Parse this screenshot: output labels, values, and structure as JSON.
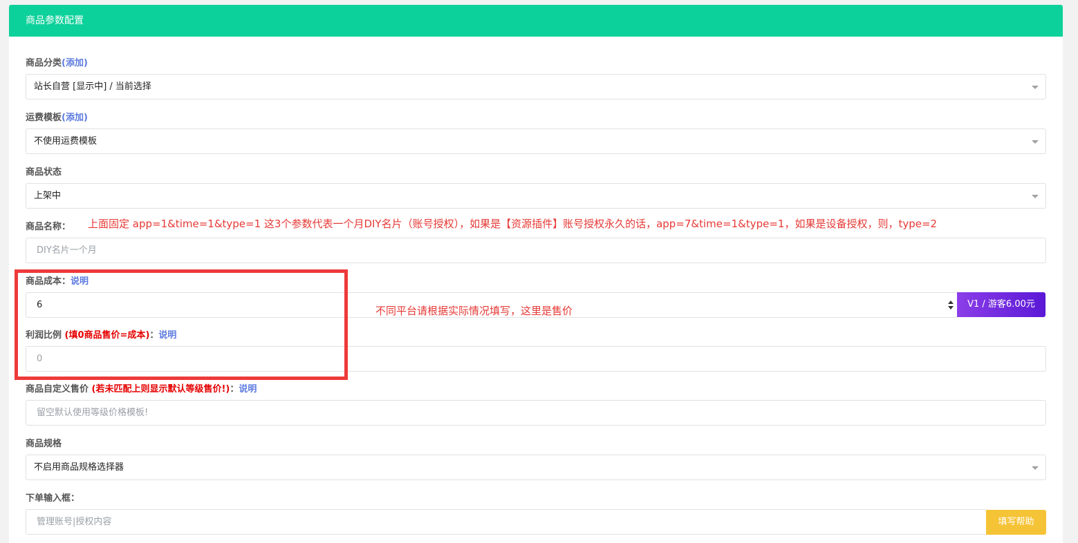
{
  "header": {
    "title": "商品参数配置"
  },
  "category": {
    "label": "商品分类",
    "link_open": "(",
    "link": "添加",
    "link_close": ")",
    "value": "站长自营 [显示中] / 当前选择"
  },
  "shipping": {
    "label": "运费模板",
    "link_open": "(",
    "link": "添加",
    "link_close": ")",
    "value": "不使用运费模板"
  },
  "status": {
    "label": "商品状态",
    "value": "上架中"
  },
  "name": {
    "label": "商品名称：",
    "placeholder": "DIY名片一个月"
  },
  "annotation_top": "上面固定  app=1&time=1&type=1   这3个参数代表一个月DIY名片（账号授权），如果是【资源插件】账号授权永久的话，app=7&time=1&type=1，如果是设备授权，则，type=2",
  "cost": {
    "label": "商品成本：",
    "link": "说明",
    "value": "6",
    "addon": "V1 / 游客6.00元"
  },
  "annotation_price": "不同平台请根据实际情况填写，这里是售价",
  "profit": {
    "label": "利润比例 ",
    "paren_open": "(",
    "hint": "填0商品售价=成本",
    "paren_close": ")",
    "suffix": "：",
    "link": "说明",
    "value": "0"
  },
  "custom_price": {
    "label": "商品自定义售价 ",
    "paren_open": "(",
    "hint": "若未匹配上则显示默认等级售价!",
    "paren_close": ")",
    "suffix": "：",
    "link": "说明",
    "placeholder": "留空默认使用等级价格模板!"
  },
  "spec": {
    "label": "商品规格",
    "value": "不启用商品规格选择器"
  },
  "order_input": {
    "label": "下单输入框：",
    "placeholder": "管理账号|授权内容",
    "addon": "填写帮助"
  },
  "colors": {
    "header_bg": "#0dd19a",
    "annotation": "#e53935",
    "link": "#5d7be0",
    "purple_addon": "#6c2ce0",
    "yellow_addon": "#f5c336"
  }
}
